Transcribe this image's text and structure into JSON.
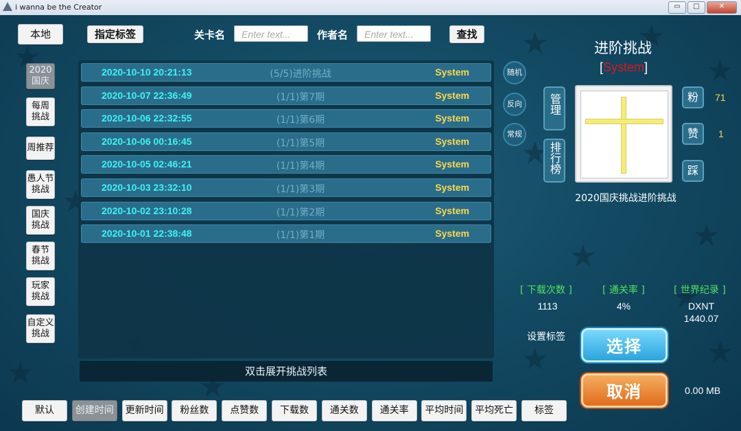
{
  "window": {
    "title": "i wanna be the Creator",
    "minimize": "▭",
    "maximize": "□",
    "close": "✕"
  },
  "toolbar": {
    "local_button": "本地",
    "tag_button": "指定标签",
    "level_name_label": "关卡名",
    "level_name_placeholder": "Enter text...",
    "author_label": "作者名",
    "author_placeholder": "Enter text...",
    "search_button": "查找"
  },
  "sidebar": {
    "items": [
      {
        "label": "2020\n国庆",
        "active": true
      },
      {
        "label": "每周\n挑战",
        "active": false
      },
      {
        "label": "周推荐",
        "active": false
      },
      {
        "label": "愚人节\n挑战",
        "active": false
      },
      {
        "label": "国庆\n挑战",
        "active": false
      },
      {
        "label": "春节\n挑战",
        "active": false
      },
      {
        "label": "玩家\n挑战",
        "active": false
      },
      {
        "label": "自定义\n挑战",
        "active": false
      }
    ]
  },
  "list": {
    "rows": [
      {
        "date": "2020-10-10 20:21:13",
        "name": "(5/5)进阶挑战",
        "author": "System"
      },
      {
        "date": "2020-10-07 22:36:49",
        "name": "(1/1)第7期",
        "author": "System"
      },
      {
        "date": "2020-10-06 22:32:55",
        "name": "(1/1)第6期",
        "author": "System"
      },
      {
        "date": "2020-10-06 00:16:45",
        "name": "(1/1)第5期",
        "author": "System"
      },
      {
        "date": "2020-10-05 02:46:21",
        "name": "(1/1)第4期",
        "author": "System"
      },
      {
        "date": "2020-10-03 23:32:10",
        "name": "(1/1)第3期",
        "author": "System"
      },
      {
        "date": "2020-10-02 23:10:28",
        "name": "(1/1)第2期",
        "author": "System"
      },
      {
        "date": "2020-10-01 22:38:48",
        "name": "(1/1)第1期",
        "author": "System"
      }
    ],
    "footer_hint": "双击展开挑战列表"
  },
  "mode_buttons": {
    "random": "随机",
    "reverse": "反向",
    "normal": "常规"
  },
  "detail": {
    "title": "进阶挑战",
    "author_open": "[",
    "author": "System",
    "author_close": "]",
    "manage_button": "管理",
    "ranking_button": "排行榜",
    "fans_button": "粉",
    "fans_count": "71",
    "like_button": "赞",
    "like_count": "1",
    "dislike_button": "踩",
    "caption": "2020国庆挑战进阶挑战",
    "stats": {
      "downloads_label": "[ 下载次数 ]",
      "downloads_value": "1113",
      "clear_rate_label": "[ 通关率 ]",
      "clear_rate_value": "4%",
      "world_record_label": "[ 世界纪录 ]",
      "world_record_holder": "DXNT",
      "world_record_time": "1440.07"
    },
    "set_tag_label": "设置标签",
    "select_button": "选择",
    "cancel_button": "取消",
    "size": "0.00 MB"
  },
  "sort_bar": {
    "buttons": [
      {
        "label": "默认",
        "active": false
      },
      {
        "label": "创建时间",
        "active": true
      },
      {
        "label": "更新时间",
        "active": false
      },
      {
        "label": "粉丝数",
        "active": false
      },
      {
        "label": "点赞数",
        "active": false
      },
      {
        "label": "下载数",
        "active": false
      },
      {
        "label": "通关数",
        "active": false
      },
      {
        "label": "通关率",
        "active": false
      },
      {
        "label": "平均时间",
        "active": false
      },
      {
        "label": "平均死亡",
        "active": false
      },
      {
        "label": "标签",
        "active": false
      }
    ]
  },
  "colors": {
    "accent_cyan": "#3ef3f6",
    "author_yellow": "#ffd84a",
    "stat_green": "#4fe35a",
    "author_red": "#e0141e",
    "select_blue": "#2ba4df",
    "cancel_orange": "#e16c1c"
  }
}
